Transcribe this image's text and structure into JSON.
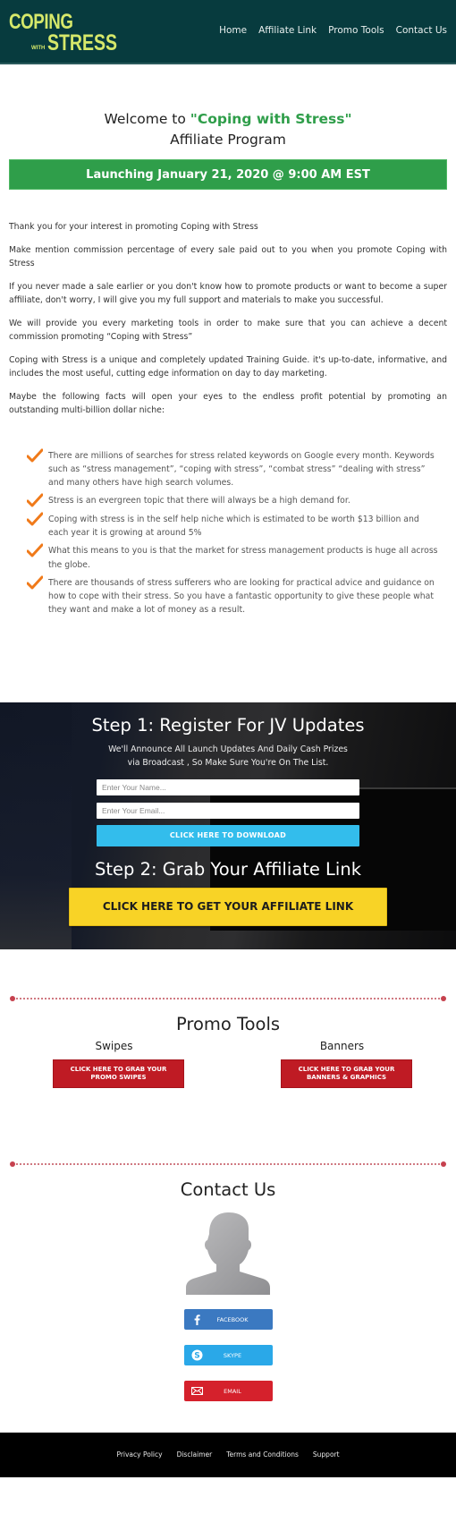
{
  "header": {
    "logo": {
      "line1": "COPING",
      "small": "WITH",
      "line2": "STRESS"
    },
    "nav": [
      "Home",
      "Affiliate Link",
      "Promo Tools",
      "Contact Us"
    ]
  },
  "welcome": {
    "prefix": "Welcome to ",
    "brand": "\"Coping with Stress\"",
    "line2": "Affiliate Program",
    "launch": "Launching January 21, 2020 @ 9:00 AM EST"
  },
  "intro": {
    "paragraphs": [
      "Thank you for your interest in promoting Coping with Stress",
      "Make mention commission percentage of every sale paid out to you when you promote Coping with Stress",
      "If you never made a sale earlier or you don't know how to promote products or want to become a super affiliate, don't worry, I will give you my full support and materials to make you successful.",
      "We will provide you every marketing tools in order to make sure that you can achieve a decent commission promoting “Coping with Stress”",
      "Coping with Stress is a unique and completely updated Training Guide. it's up-to-date, informative, and includes the most useful, cutting edge information on day to day marketing.",
      "Maybe the following facts will open your eyes to the endless profit potential by promoting an outstanding multi-billion dollar niche:"
    ],
    "facts": [
      "There are millions of searches for stress related keywords on Google every month. Keywords such as “stress management”, “coping with stress”, “combat stress” “dealing with stress” and many others have high search volumes.",
      "Stress is an evergreen topic that there will always be a high demand for.",
      "Coping with stress is in the self help niche which is estimated to be worth $13 billion and each year it is growing at around 5%",
      "What this means to you is that the market for stress management products is huge all across the globe.",
      "There are thousands of stress sufferers who are looking for practical advice and guidance on how to cope with their stress. So you have a fantastic opportunity to give these people what they want and make a lot of money as a result."
    ]
  },
  "jv": {
    "step1_title": "Step 1: Register For JV Updates",
    "step1_sub_line1": "We'll Announce All Launch Updates And Daily Cash Prizes",
    "step1_sub_line2": "via Broadcast , So Make Sure You're On The List.",
    "name_placeholder": "Enter Your Name...",
    "email_placeholder": "Enter Your Email...",
    "download_label": "CLICK HERE TO DOWNLOAD",
    "step2_title": "Step 2: Grab Your Affiliate Link",
    "affiliate_label": "CLICK HERE TO GET YOUR AFFILIATE LINK"
  },
  "promo": {
    "title": "Promo Tools",
    "columns": [
      {
        "heading": "Swipes",
        "button": "CLICK HERE TO GRAB YOUR PROMO SWIPES"
      },
      {
        "heading": "Banners",
        "button": "CLICK HERE TO GRAB YOUR BANNERS & GRAPHICS"
      }
    ]
  },
  "contact": {
    "title": "Contact Us",
    "buttons": [
      {
        "label": "FACEBOOK",
        "icon": "facebook-icon"
      },
      {
        "label": "SKYPE",
        "icon": "skype-icon"
      },
      {
        "label": "EMAIL",
        "icon": "envelope-icon"
      }
    ]
  },
  "footer": {
    "links": [
      "Privacy Policy",
      "Disclaimer",
      "Terms and Conditions",
      "Support"
    ]
  },
  "colors": {
    "header_bg": "#073b3e",
    "logo": "#d6e86a",
    "brand_green": "#2f9e4a",
    "check_orange": "#f07a1a",
    "download_blue": "#33bdec",
    "affiliate_yellow": "#f8d326",
    "promo_red": "#bf1b24",
    "facebook": "#3b79c1",
    "skype": "#2aa8e8",
    "email": "#d5212c"
  }
}
